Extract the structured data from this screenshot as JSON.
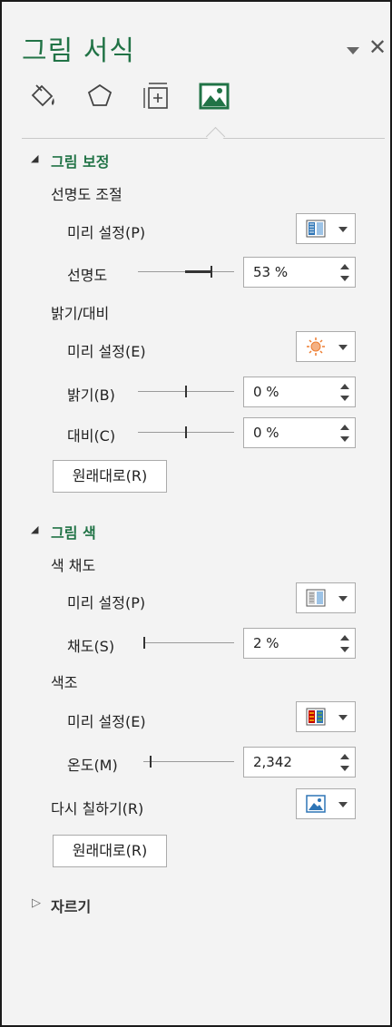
{
  "pane": {
    "title": "그림 서식",
    "tabs": [
      "fill-line-icon",
      "effects-icon",
      "size-properties-icon",
      "picture-icon"
    ],
    "active_tab": "picture-icon",
    "accent_color": "#217346"
  },
  "corrections": {
    "header": "그림 보정",
    "sharpen": {
      "title": "선명도 조절",
      "presets_label": "미리 설정(P)",
      "amount_label": "선명도",
      "amount_value": "53 %",
      "amount_fraction": 0.53
    },
    "brightness_contrast": {
      "title": "밝기/대비",
      "presets_label": "미리 설정(E)",
      "brightness_label": "밝기(B)",
      "brightness_value": "0 %",
      "contrast_label": "대비(C)",
      "contrast_value": "0 %"
    },
    "reset_label": "원래대로(R)"
  },
  "color": {
    "header": "그림 색",
    "saturation": {
      "title": "색 채도",
      "presets_label": "미리 설정(P)",
      "amount_label": "채도(S)",
      "amount_value": "2 %"
    },
    "tone": {
      "title": "색조",
      "presets_label": "미리 설정(E)",
      "temperature_label": "온도(M)",
      "temperature_value": "2,342"
    },
    "recolor_label": "다시 칠하기(R)",
    "reset_label": "원래대로(R)"
  },
  "crop": {
    "header": "자르기"
  }
}
